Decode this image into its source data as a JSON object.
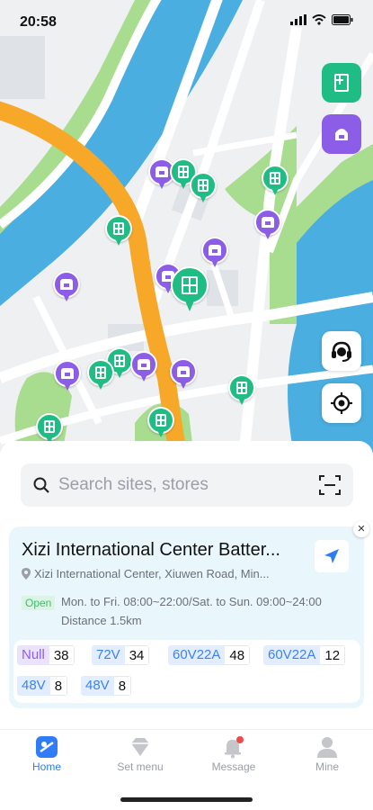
{
  "status_bar": {
    "time": "20:58"
  },
  "map": {
    "colors": {
      "water": "#4aaee0",
      "park": "#a8dc8f",
      "road": "#ffffff",
      "highway": "#f7a829",
      "land": "#eef0f2"
    }
  },
  "floating_buttons": [
    {
      "name": "battery-cabinet-filter",
      "icon": "cabinet-icon",
      "color": "#1fbd83"
    },
    {
      "name": "store-filter",
      "icon": "store-icon",
      "color": "#8c5ee8"
    },
    {
      "name": "customer-service",
      "icon": "headset-icon"
    },
    {
      "name": "locate-me",
      "icon": "crosshair-icon"
    }
  ],
  "search": {
    "placeholder": "Search sites, stores"
  },
  "site_card": {
    "name": "Xizi International Center Batter...",
    "address": "Xizi International Center, Xiuwen Road, Min...",
    "open_status": "Open",
    "hours": "Mon. to Fri. 08:00~22:00/Sat. to Sun. 09:00~24:00",
    "distance": "Distance 1.5km",
    "batteries": [
      {
        "type": "Null",
        "count": "38",
        "color": "purple"
      },
      {
        "type": "72V",
        "count": "34",
        "color": "blue"
      },
      {
        "type": "60V22A",
        "count": "48",
        "color": "blue"
      },
      {
        "type": "60V22A",
        "count": "12",
        "color": "blue"
      },
      {
        "type": "48V",
        "count": "8",
        "color": "blue"
      },
      {
        "type": "48V",
        "count": "8",
        "color": "blue"
      }
    ]
  },
  "tabs": [
    {
      "label": "Home",
      "active": true
    },
    {
      "label": "Set menu",
      "active": false
    },
    {
      "label": "Message",
      "active": false
    },
    {
      "label": "Mine",
      "active": false
    }
  ]
}
